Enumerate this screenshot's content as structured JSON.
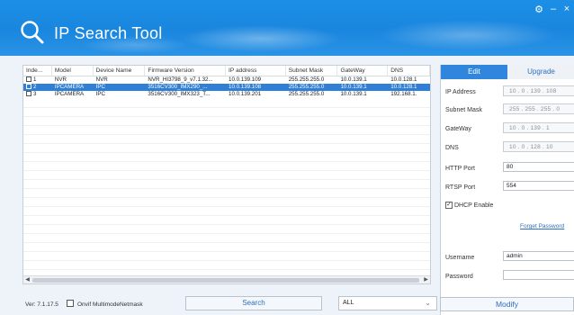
{
  "header": {
    "title": "IP Search Tool",
    "settings_icon": "⚙",
    "minimize_icon": "–",
    "close_icon": "×"
  },
  "table": {
    "columns": [
      "Inde...",
      "Model",
      "Device Name",
      "Firmware Version",
      "IP address",
      "Subnet Mask",
      "GateWay",
      "DNS"
    ],
    "rows": [
      {
        "index": "1",
        "model": "NVR",
        "device_name": "NVR",
        "firmware": "NVR_HI3798_9_v7.1.32...",
        "ip": "10.0.139.109",
        "subnet": "255.255.255.0",
        "gateway": "10.0.139.1",
        "dns": "10.0.128.1"
      },
      {
        "index": "2",
        "model": "IPCAMERA",
        "device_name": "IPC",
        "firmware": "3516CV300_IMX290_...",
        "ip": "10.0.139.108",
        "subnet": "255.255.255.0",
        "gateway": "10.0.139.1",
        "dns": "10.0.128.1"
      },
      {
        "index": "3",
        "model": "IPCAMERA",
        "device_name": "IPC",
        "firmware": "3516CV300_IMX323_T...",
        "ip": "10.0.139.201",
        "subnet": "255.255.255.0",
        "gateway": "10.0.139.1",
        "dns": "192.168.1."
      }
    ],
    "selected_row": 2
  },
  "bottom": {
    "version": "Ver: 7.1.17.5",
    "onvif_label": "Onvif MultimodeNetmask",
    "search_label": "Search",
    "filter_value": "ALL"
  },
  "edit_panel": {
    "tab_edit": "Edit",
    "tab_upgrade": "Upgrade",
    "ip_address_label": "IP Address",
    "ip_address_value": "10  .  0  .  139  .  108",
    "subnet_label": "Subnet Mask",
    "subnet_value": "255  .  255  .  255  .  0",
    "gateway_label": "GateWay",
    "gateway_value": "10  .  0  .  139  .  1",
    "dns_label": "DNS",
    "dns_value": "10  .  0  .  128  .  10",
    "http_port_label": "HTTP Port",
    "http_port_value": "80",
    "rtsp_port_label": "RTSP Port",
    "rtsp_port_value": "554",
    "dhcp_label": "DHCP Enable",
    "username_label": "Username",
    "username_value": "admin",
    "password_label": "Password",
    "password_value": "",
    "forget_label": "Forget Password",
    "modify_label": "Modify"
  },
  "colors": {
    "header": "#1a86de",
    "selected_row": "#2f7fd6",
    "accent": "#2d6fc0"
  }
}
